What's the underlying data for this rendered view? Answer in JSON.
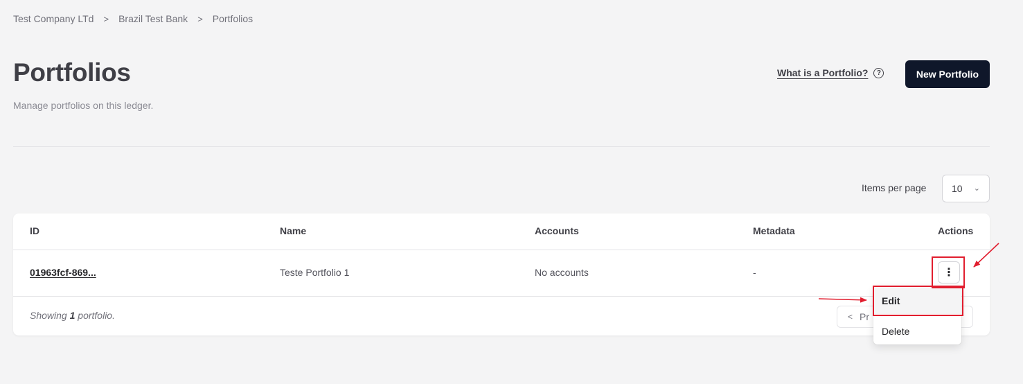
{
  "breadcrumb": [
    "Test Company LTd",
    "Brazil Test Bank",
    "Portfolios"
  ],
  "breadcrumb_separator": ">",
  "page": {
    "title": "Portfolios",
    "subtitle": "Manage portfolios on this ledger."
  },
  "help_link": {
    "label": "What is a Portfolio?",
    "icon": "help-circle-icon",
    "icon_glyph": "?"
  },
  "new_button": {
    "label": "New Portfolio"
  },
  "pagination": {
    "items_per_page_label": "Items per page",
    "items_per_page_value": "10",
    "prev_label": "Pr"
  },
  "table": {
    "columns": [
      "ID",
      "Name",
      "Accounts",
      "Metadata",
      "Actions"
    ],
    "rows": [
      {
        "id": "01963fcf-869...",
        "name": "Teste Portfolio 1",
        "accounts": "No accounts",
        "metadata": "-"
      }
    ],
    "footer": {
      "prefix": "Showing",
      "count": "1",
      "suffix": "portfolio."
    },
    "actions_glyph": "⋮"
  },
  "menu": {
    "items": [
      "Edit",
      "Delete"
    ],
    "active": "Edit"
  },
  "colors": {
    "background": "#f4f4f5",
    "primary_button": "#0f172a",
    "annotation": "#e11d2e"
  }
}
